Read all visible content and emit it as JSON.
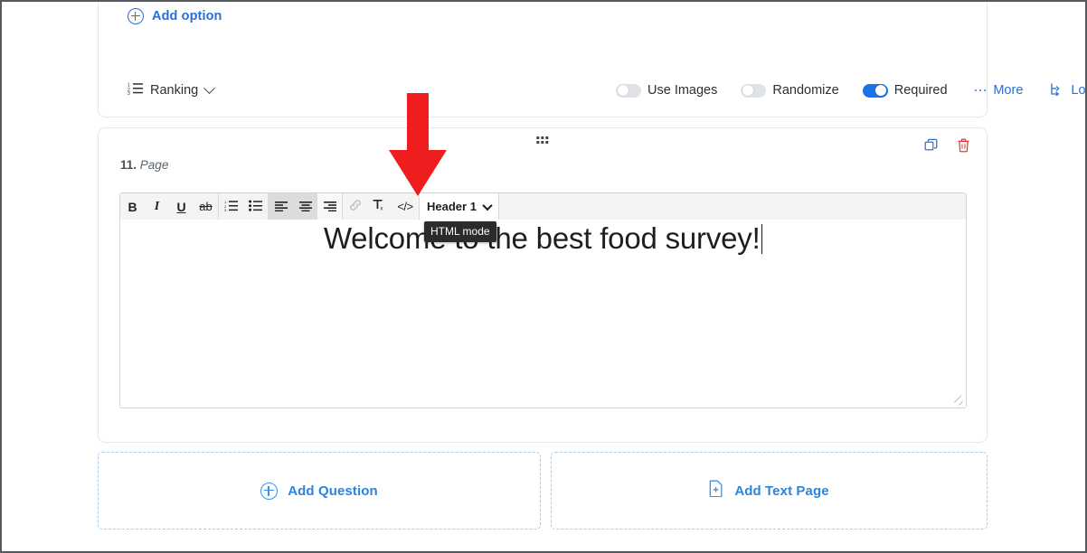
{
  "ranking_card": {
    "add_option_label": "Add option",
    "question_type": "Ranking",
    "options": [
      {
        "label": "Use Images",
        "state": "off"
      },
      {
        "label": "Randomize",
        "state": "off"
      },
      {
        "label": "Required",
        "state": "on"
      }
    ],
    "more_label": "More",
    "logic_label": "Logic"
  },
  "page_card": {
    "index_label": "11.",
    "type_label": "Page",
    "actions": [
      {
        "name": "duplicate",
        "color": "#2f72c4"
      },
      {
        "name": "delete",
        "color": "#e03b36"
      }
    ]
  },
  "editor": {
    "toolbar": {
      "bold": "B",
      "italic": "I",
      "underline": "U",
      "strikethrough": "ab",
      "ordered_list": "ordered-list",
      "bullet_list": "bullet-list",
      "align_left": "align-left",
      "align_center": "align-center",
      "align_right": "align-right",
      "link": "link",
      "clear_format": "Tx",
      "html_mode": "</>",
      "heading_select": "Header 1"
    },
    "tooltip": "HTML mode",
    "content": "Welcome to the best food survey!"
  },
  "footer": {
    "add_question_label": "Add Question",
    "add_text_page_label": "Add Text Page"
  },
  "annotation": {
    "arrow_color": "#ef1d1d",
    "points_to": "html-mode-button"
  },
  "colors": {
    "link_blue": "#2a6fd6",
    "toggle_on": "#1a73e8",
    "dashed_border": "#9fcdf3",
    "delete_red": "#e03b36"
  }
}
